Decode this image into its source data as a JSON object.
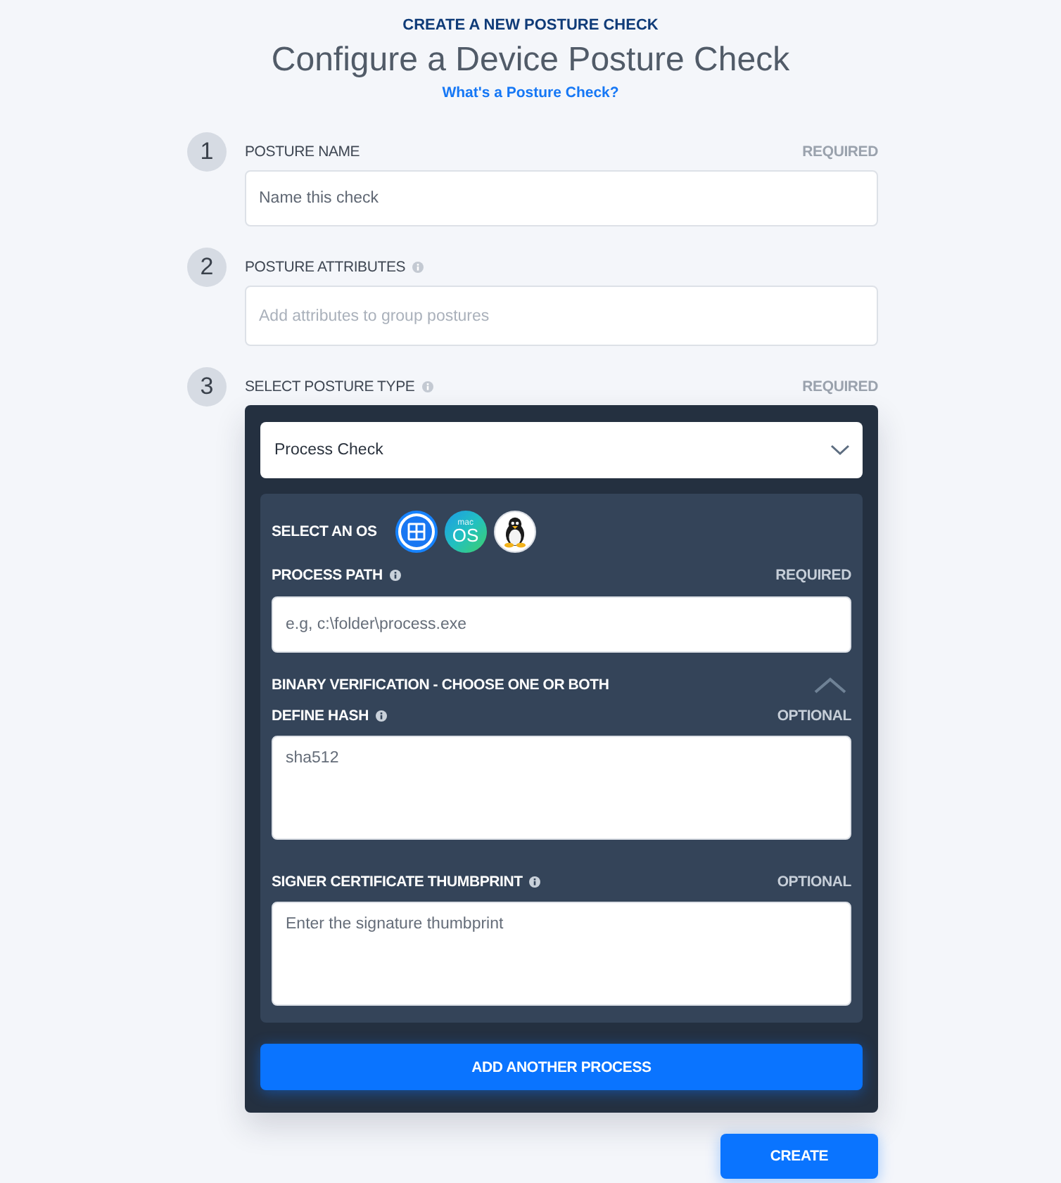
{
  "header": {
    "kicker": "CREATE A NEW POSTURE CHECK",
    "title": "Configure a Device Posture Check",
    "help_link": "What's a Posture Check?"
  },
  "steps": [
    {
      "number": "1",
      "label": "POSTURE NAME",
      "tag": "REQUIRED",
      "field": {
        "kind": "text",
        "placeholder": "Name this check"
      }
    },
    {
      "number": "2",
      "label": "POSTURE ATTRIBUTES",
      "info": true,
      "field": {
        "kind": "tags",
        "placeholder": "Add attributes to group postures"
      }
    },
    {
      "number": "3",
      "label": "SELECT POSTURE TYPE",
      "info": true,
      "tag": "REQUIRED",
      "field": {
        "kind": "type_panel",
        "select": {
          "value": "Process Check"
        },
        "os_label": "SELECT AN OS",
        "os_options": [
          {
            "kind": "windows",
            "selected": true
          },
          {
            "kind": "macos",
            "selected": false,
            "logo_small": "mac",
            "logo": "OS"
          },
          {
            "kind": "linux",
            "selected": false
          }
        ],
        "process_path": {
          "label": "PROCESS PATH",
          "info": true,
          "tag": "REQUIRED",
          "placeholder": "e.g, c:\\folder\\process.exe"
        },
        "verification": {
          "label": "BINARY VERIFICATION - CHOOSE ONE OR BOTH",
          "expanded": true,
          "fields": [
            {
              "label": "DEFINE HASH",
              "info": true,
              "tag": "OPTIONAL",
              "placeholder": "sha512"
            },
            {
              "label": "SIGNER CERTIFICATE THUMBPRINT",
              "info": true,
              "tag": "OPTIONAL",
              "placeholder": "Enter the signature thumbprint"
            }
          ]
        },
        "add_button": "ADD ANOTHER PROCESS"
      }
    }
  ],
  "create_button": "CREATE"
}
